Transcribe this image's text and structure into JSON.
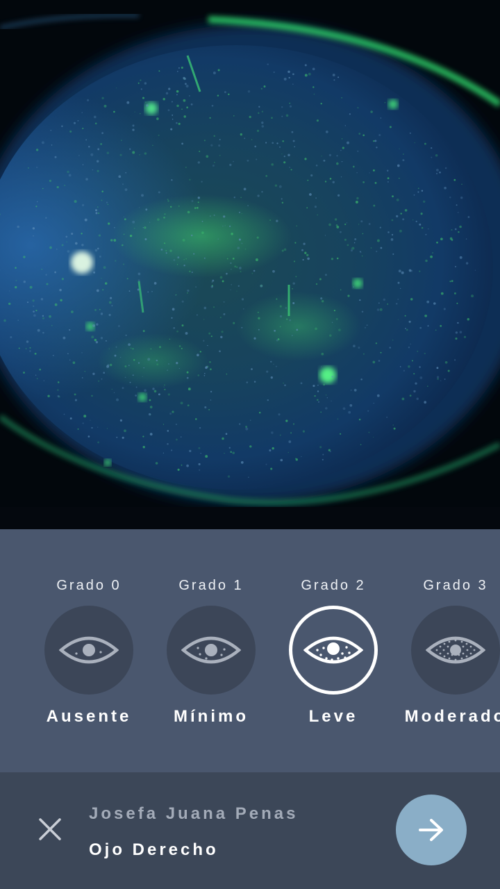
{
  "photo": {
    "subject": "fluorescein-stained-cornea"
  },
  "grades": [
    {
      "grade_label": "Grado 0",
      "name": "Ausente",
      "selected": false,
      "icon": "eye-icon"
    },
    {
      "grade_label": "Grado 1",
      "name": "Mínimo",
      "selected": false,
      "icon": "eye-few-dots-icon"
    },
    {
      "grade_label": "Grado 2",
      "name": "Leve",
      "selected": true,
      "icon": "eye-dots-icon"
    },
    {
      "grade_label": "Grado 3",
      "name": "Moderado",
      "selected": false,
      "icon": "eye-many-dots-icon"
    }
  ],
  "footer": {
    "patient_name": "Josefa Juana Penas",
    "eye_side": "Ojo Derecho",
    "close_icon": "close-icon",
    "next_icon": "arrow-right-icon"
  },
  "colors": {
    "panel_bg": "#4a576e",
    "footer_bg": "#3c4758",
    "circle_bg": "#3c4658",
    "accent_button": "#8aaec7"
  }
}
